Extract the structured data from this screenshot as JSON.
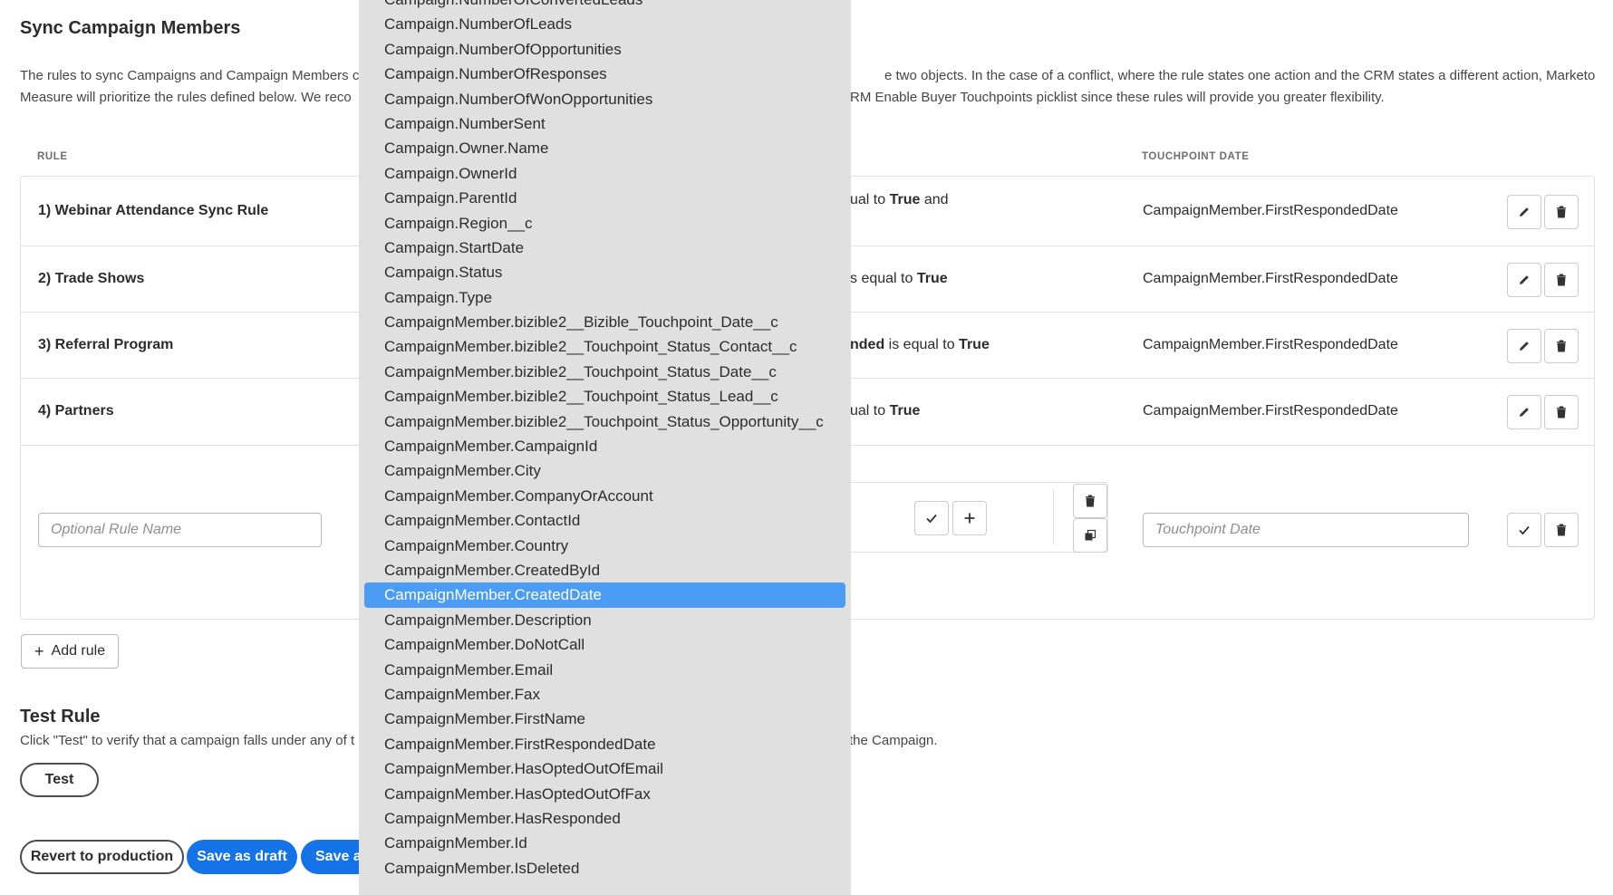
{
  "page": {
    "title": "Sync Campaign Members",
    "intro_left_line1": "The rules to sync Campaigns and Campaign Members c",
    "intro_left_line2": "Measure will prioritize the rules defined below. We reco",
    "intro_right_line1": "e two objects. In the case of a conflict, where the rule states one action and the CRM states a different action, Marketo",
    "intro_right_line2": "RM Enable Buyer Touchpoints picklist since these rules will provide you greater flexibility."
  },
  "table": {
    "col_rule": "RULE",
    "col_touchpoint_date": "TOUCHPOINT DATE",
    "rows": [
      {
        "name": "1) Webinar Attendance Sync Rule",
        "cond_pre": "ual to ",
        "cond_bold": "True",
        "cond_post": " and",
        "date": "CampaignMember.FirstRespondedDate"
      },
      {
        "name": "2) Trade Shows",
        "cond_pre": "s equal to ",
        "cond_bold": "True",
        "cond_post": "",
        "date": "CampaignMember.FirstRespondedDate"
      },
      {
        "name": "3) Referral Program",
        "cond_bold_pre": "nded",
        "cond_pre": " is equal to ",
        "cond_bold": "True",
        "cond_post": "",
        "date": "CampaignMember.FirstRespondedDate"
      },
      {
        "name": "4) Partners",
        "cond_pre": "ual to ",
        "cond_bold": "True",
        "cond_post": "",
        "date": "CampaignMember.FirstRespondedDate"
      }
    ],
    "new_rule": {
      "name_placeholder": "Optional Rule Name",
      "date_placeholder": "Touchpoint Date"
    }
  },
  "add_rule_label": "Add rule",
  "test": {
    "title": "Test Rule",
    "desc_left": "Click \"Test\" to verify that a campaign falls under any of t",
    "desc_right": "the Campaign.",
    "button": "Test"
  },
  "footer": {
    "revert": "Revert to production",
    "save_draft": "Save as draft",
    "save_other": "Save a"
  },
  "dropdown": {
    "selected_index": 24,
    "options": [
      "Campaign.NumberOfConvertedLeads",
      "Campaign.NumberOfLeads",
      "Campaign.NumberOfOpportunities",
      "Campaign.NumberOfResponses",
      "Campaign.NumberOfWonOpportunities",
      "Campaign.NumberSent",
      "Campaign.Owner.Name",
      "Campaign.OwnerId",
      "Campaign.ParentId",
      "Campaign.Region__c",
      "Campaign.StartDate",
      "Campaign.Status",
      "Campaign.Type",
      "CampaignMember.bizible2__Bizible_Touchpoint_Date__c",
      "CampaignMember.bizible2__Touchpoint_Status_Contact__c",
      "CampaignMember.bizible2__Touchpoint_Status_Date__c",
      "CampaignMember.bizible2__Touchpoint_Status_Lead__c",
      "CampaignMember.bizible2__Touchpoint_Status_Opportunity__c",
      "CampaignMember.CampaignId",
      "CampaignMember.City",
      "CampaignMember.CompanyOrAccount",
      "CampaignMember.ContactId",
      "CampaignMember.Country",
      "CampaignMember.CreatedById",
      "CampaignMember.CreatedDate",
      "CampaignMember.Description",
      "CampaignMember.DoNotCall",
      "CampaignMember.Email",
      "CampaignMember.Fax",
      "CampaignMember.FirstName",
      "CampaignMember.FirstRespondedDate",
      "CampaignMember.HasOptedOutOfEmail",
      "CampaignMember.HasOptedOutOfFax",
      "CampaignMember.HasResponded",
      "CampaignMember.Id",
      "CampaignMember.IsDeleted"
    ]
  },
  "colors": {
    "accent": "#1473e6",
    "selected_option": "#4b9cf5",
    "dropdown_bg": "#e0e0e0"
  },
  "icons": [
    "pencil-icon",
    "trash-icon",
    "check-icon",
    "plus-icon",
    "copy-icon"
  ]
}
